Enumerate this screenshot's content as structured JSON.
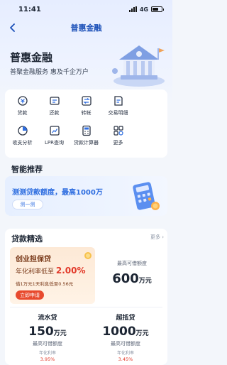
{
  "status": {
    "time": "11:41",
    "network": "4G"
  },
  "nav": {
    "title": "普惠金融"
  },
  "hero": {
    "title": "普惠金融",
    "subtitle": "普聚金融服务 惠及千企万户"
  },
  "grid": [
    {
      "label": "贷款",
      "icon": "loan-icon"
    },
    {
      "label": "还款",
      "icon": "repay-icon"
    },
    {
      "label": "转帐",
      "icon": "transfer-icon"
    },
    {
      "label": "交易明细",
      "icon": "transaction-detail-icon"
    },
    {
      "label": "收支分析",
      "icon": "pie-chart-icon"
    },
    {
      "label": "LPR查询",
      "icon": "lpr-icon"
    },
    {
      "label": "贷款计算器",
      "icon": "calculator-icon"
    },
    {
      "label": "更多",
      "icon": "more-grid-icon"
    }
  ],
  "recommend": {
    "title": "智能推荐",
    "text": "测测贷款额度，最高1000万",
    "button": "测一测"
  },
  "selection": {
    "title": "贷款精选",
    "more": "更多",
    "promo": {
      "name": "创业担保贷",
      "rate_prefix": "年化利率低至",
      "rate": "2.00%",
      "note": "借1万元1天利息低至0.56元",
      "button": "立即申请"
    },
    "quota": {
      "label": "最高可借额度",
      "amount": "600",
      "unit": "万元"
    },
    "products": [
      {
        "name": "流水贷",
        "amount": "150",
        "unit": "万元",
        "label": "最高可借额度",
        "rate_label": "年化利率",
        "rate": "3.95%"
      },
      {
        "name": "超抵贷",
        "amount": "1000",
        "unit": "万元",
        "label": "最高可借额度",
        "rate_label": "年化利率",
        "rate": "3.45%"
      }
    ]
  },
  "colors": {
    "primary": "#2f6ee0",
    "accent": "#e84a2e",
    "promo_bg": "#fde9d6"
  }
}
